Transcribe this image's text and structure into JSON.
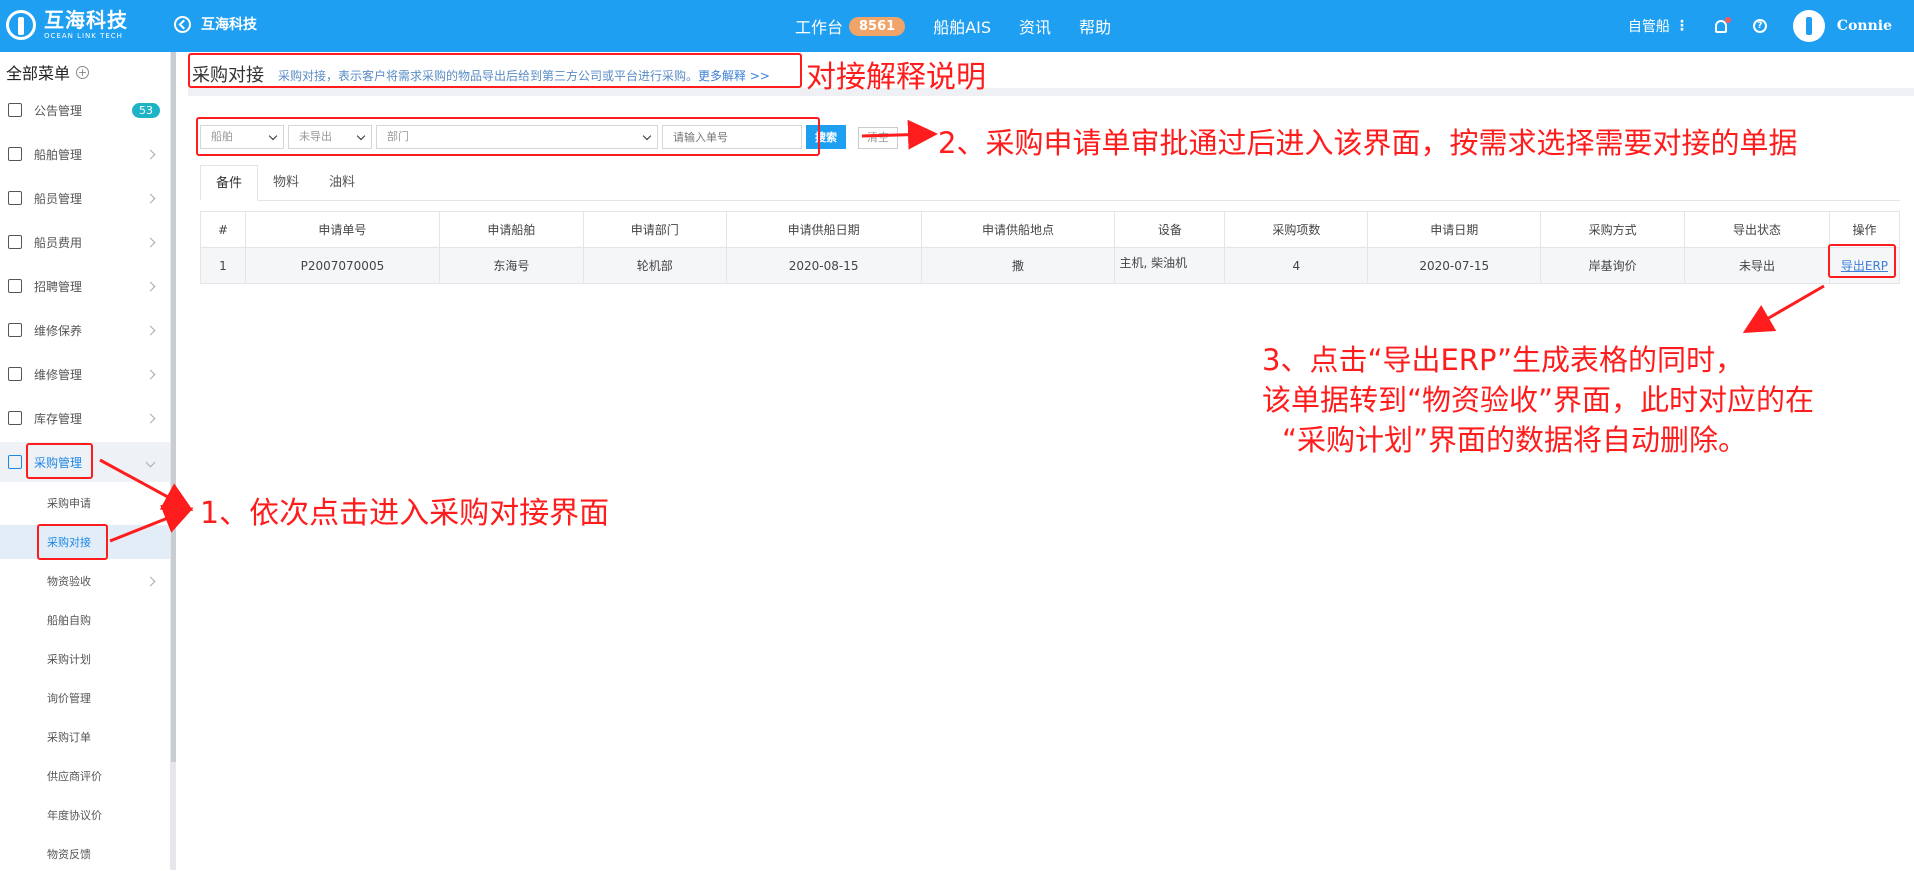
{
  "topbar": {
    "logo_cn": "互海科技",
    "logo_en": "OCEAN LINK TECH",
    "back_label": "互海科技",
    "nav": [
      {
        "label": "工作台",
        "badge": "8561"
      },
      {
        "label": "船舶AIS"
      },
      {
        "label": "资讯"
      },
      {
        "label": "帮助"
      }
    ],
    "ship_mode": "自管船",
    "username": "Connie"
  },
  "sidebar": {
    "header": "全部菜单",
    "items": [
      {
        "label": "公告管理",
        "badge": "53",
        "icon": "notice-icon"
      },
      {
        "label": "船舶管理",
        "icon": "anchor-icon"
      },
      {
        "label": "船员管理",
        "icon": "person-icon"
      },
      {
        "label": "船员费用",
        "icon": "wallet-icon"
      },
      {
        "label": "招聘管理",
        "icon": "recruit-icon"
      },
      {
        "label": "维修保养",
        "icon": "hammer-icon"
      },
      {
        "label": "维修管理",
        "icon": "wrench-icon"
      },
      {
        "label": "库存管理",
        "icon": "warehouse-icon"
      },
      {
        "label": "采购管理",
        "icon": "cart-icon"
      }
    ],
    "sub_items": [
      "采购申请",
      "采购对接",
      "物资验收",
      "船舶自购",
      "采购计划",
      "询价管理",
      "采购订单",
      "供应商评价",
      "年度协议价",
      "物资反馈"
    ]
  },
  "page": {
    "title": "采购对接",
    "description": "采购对接，表示客户将需求采购的物品导出后给到第三方公司或平台进行采购。",
    "more_link": "更多解释 >>"
  },
  "filters": {
    "ship": "船舶",
    "export_status": "未导出",
    "department": "部门",
    "order_placeholder": "请输入单号",
    "search_label": "搜索",
    "clear_label": "清空"
  },
  "tabs": [
    "备件",
    "物料",
    "油料"
  ],
  "table": {
    "headers": [
      "#",
      "申请单号",
      "申请船舶",
      "申请部门",
      "申请供船日期",
      "申请供船地点",
      "设备",
      "采购项数",
      "申请日期",
      "采购方式",
      "导出状态",
      "操作"
    ],
    "rows": [
      [
        "1",
        "P2007070005",
        "东海号",
        "轮机部",
        "2020-08-15",
        "撒",
        "主机, 柴油机",
        "4",
        "2020-07-15",
        "岸基询价",
        "未导出",
        "导出ERP"
      ]
    ]
  },
  "annotations": {
    "title_note": "对接解释说明",
    "step1": "1、依次点击进入采购对接界面",
    "step2": "2、采购申请单审批通过后进入该界面，按需求选择需要对接的单据",
    "step3_line1": "3、点击“导出ERP”生成表格的同时，",
    "step3_line2": "该单据转到“物资验收”界面，此时对应的在",
    "step3_line3": "“采购计划”界面的数据将自动删除。"
  },
  "colors": {
    "brand": "#1e9ff2",
    "annotation": "#ff1c1c",
    "badge_orange": "#f0a469",
    "badge_teal": "#1fb3c8"
  }
}
